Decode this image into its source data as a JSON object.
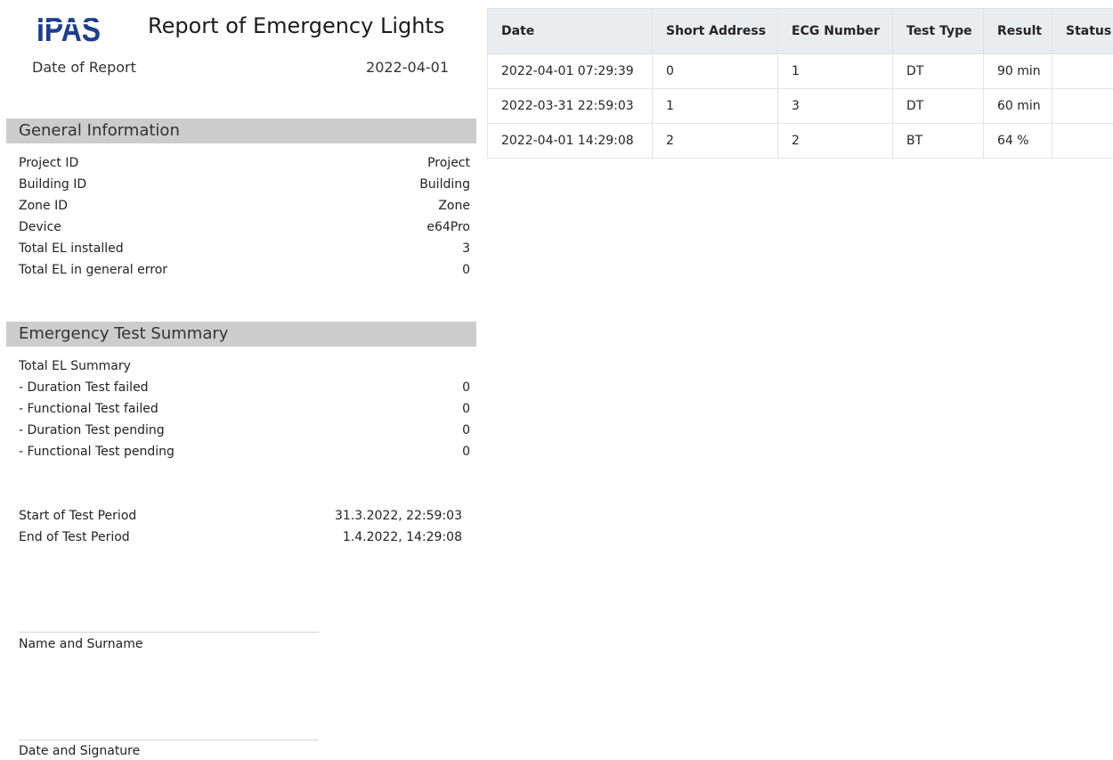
{
  "header": {
    "logo_text": "IPAS",
    "title": "Report of Emergency Lights",
    "date_label": "Date of Report",
    "date_value": "2022-04-01"
  },
  "general_information": {
    "heading": "General Information",
    "rows": [
      {
        "label": "Project ID",
        "value": "Project"
      },
      {
        "label": "Building ID",
        "value": "Building"
      },
      {
        "label": "Zone ID",
        "value": "Zone"
      },
      {
        "label": "Device",
        "value": "e64Pro"
      },
      {
        "label": "Total EL installed",
        "value": "3"
      },
      {
        "label": "Total EL in general error",
        "value": "0"
      }
    ]
  },
  "emergency_test_summary": {
    "heading": "Emergency Test Summary",
    "summary_label": "Total EL Summary",
    "rows": [
      {
        "label": "- Duration Test failed",
        "value": "0"
      },
      {
        "label": "- Functional Test failed",
        "value": "0"
      },
      {
        "label": "- Duration Test pending",
        "value": "0"
      },
      {
        "label": "- Functional Test pending",
        "value": "0"
      }
    ]
  },
  "test_period": {
    "start_label": "Start of Test Period",
    "start_value": "31.3.2022, 22:59:03",
    "end_label": "End of Test Period",
    "end_value": "1.4.2022, 14:29:08"
  },
  "signature": {
    "name_label": "Name and Surname",
    "date_label": "Date and Signature"
  },
  "results_table": {
    "columns": [
      "Date",
      "Short Address",
      "ECG Number",
      "Test Type",
      "Result",
      "Status"
    ],
    "rows": [
      [
        "2022-04-01 07:29:39",
        "0",
        "1",
        "DT",
        "90 min",
        ""
      ],
      [
        "2022-03-31 22:59:03",
        "1",
        "3",
        "DT",
        "60 min",
        ""
      ],
      [
        "2022-04-01 14:29:08",
        "2",
        "2",
        "BT",
        "64 %",
        ""
      ]
    ]
  },
  "colors": {
    "logo_blue": "#1d3f8a",
    "section_bar": "#cccccc",
    "table_header": "#eaedf0"
  }
}
